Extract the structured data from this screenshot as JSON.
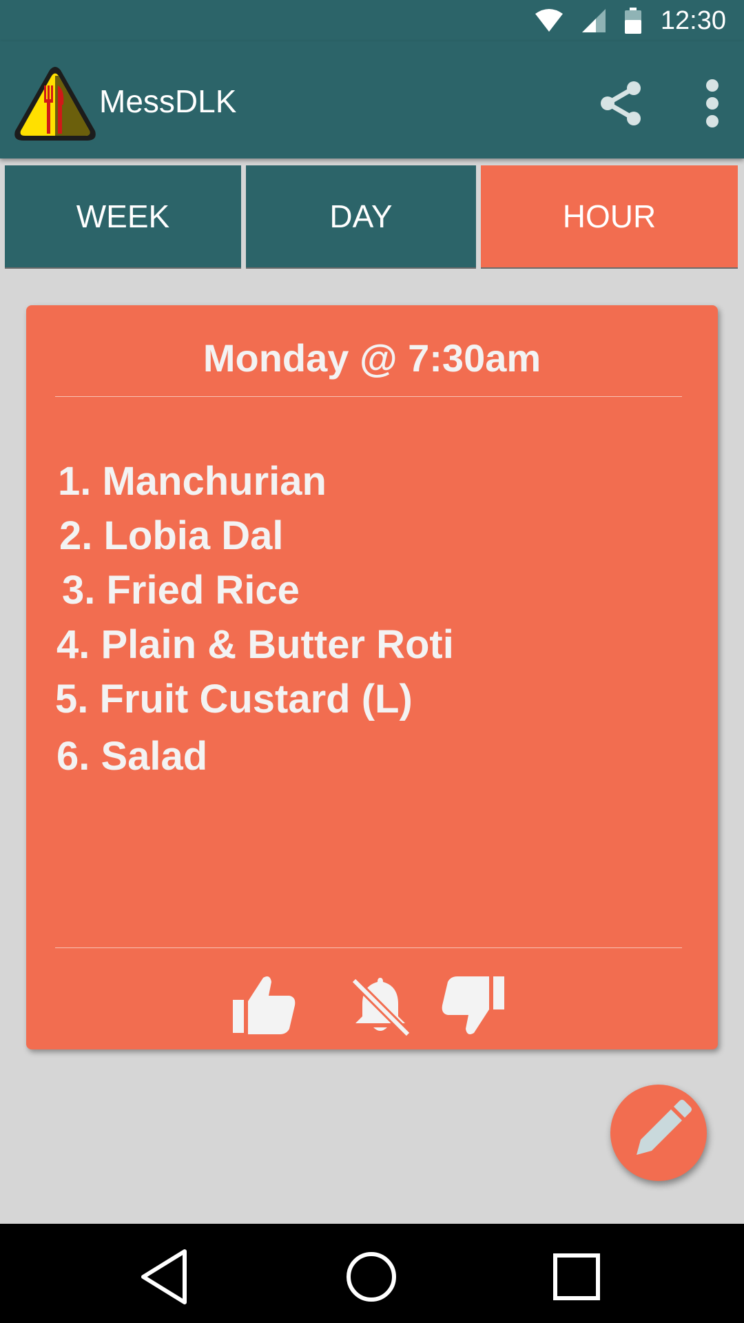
{
  "status_bar": {
    "time": "12:30",
    "icons": [
      "wifi-icon",
      "signal-icon",
      "battery-icon"
    ]
  },
  "app_bar": {
    "title": "MessDLK",
    "actions": [
      "share-icon",
      "more-vert-icon"
    ]
  },
  "tabs": [
    {
      "label": "WEEK",
      "active": false
    },
    {
      "label": "DAY",
      "active": false
    },
    {
      "label": "HOUR",
      "active": true
    }
  ],
  "card": {
    "title": "Monday @ 7:30am",
    "items": [
      "1. Manchurian",
      "2. Lobia Dal",
      "3. Fried Rice",
      "4. Plain & Butter Roti",
      "5. Fruit Custard (L)",
      "6. Salad"
    ],
    "actions": [
      "thumbs-up-icon",
      "notifications-off-icon",
      "thumbs-down-icon"
    ]
  },
  "fab": {
    "icon": "edit-icon"
  },
  "nav_bar": {
    "buttons": [
      "back-icon",
      "home-icon",
      "recents-icon"
    ]
  },
  "colors": {
    "primary": "#2c6469",
    "accent": "#f26d50",
    "background": "#d6d6d6"
  }
}
